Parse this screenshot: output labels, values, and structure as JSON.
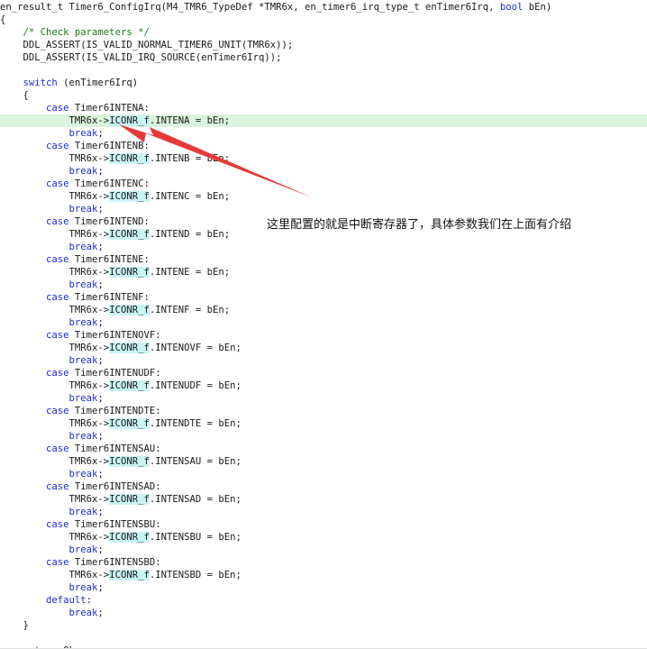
{
  "editor": {
    "current_line": 9,
    "lines": [
      [
        {
          "t": "en_result_t Timer6_ConfigIrq(M4_TMR6_TypeDef *TMR6x, en_timer6_irq_type_t enTimer6Irq, "
        },
        {
          "t": "bool",
          "c": "kw"
        },
        {
          "t": " bEn)"
        }
      ],
      [
        {
          "t": "{"
        }
      ],
      [
        {
          "t": "    "
        },
        {
          "t": "/* Check parameters */",
          "c": "cm"
        }
      ],
      [
        {
          "t": "    DDL_ASSERT(IS_VALID_NORMAL_TIMER6_UNIT(TMR6x));"
        }
      ],
      [
        {
          "t": "    DDL_ASSERT(IS_VALID_IRQ_SOURCE(enTimer6Irq));"
        }
      ],
      [
        {
          "t": ""
        }
      ],
      [
        {
          "t": "    "
        },
        {
          "t": "switch",
          "c": "kw"
        },
        {
          "t": " (enTimer6Irq)"
        }
      ],
      [
        {
          "t": "    {"
        }
      ],
      [
        {
          "t": "        "
        },
        {
          "t": "case",
          "c": "kw"
        },
        {
          "t": " Timer6INTENA:"
        }
      ],
      [
        {
          "t": "            TMR6x->"
        },
        {
          "t": "ICONR_f",
          "c": "hl"
        },
        {
          "t": ".INTENA = bEn;"
        }
      ],
      [
        {
          "t": "            "
        },
        {
          "t": "break",
          "c": "kw"
        },
        {
          "t": ";"
        }
      ],
      [
        {
          "t": "        "
        },
        {
          "t": "case",
          "c": "kw"
        },
        {
          "t": " Timer6INTENB:"
        }
      ],
      [
        {
          "t": "            TMR6x->"
        },
        {
          "t": "ICONR_f",
          "c": "hl"
        },
        {
          "t": ".INTENB = bEn;"
        }
      ],
      [
        {
          "t": "            "
        },
        {
          "t": "break",
          "c": "kw"
        },
        {
          "t": ";"
        }
      ],
      [
        {
          "t": "        "
        },
        {
          "t": "case",
          "c": "kw"
        },
        {
          "t": " Timer6INTENC:"
        }
      ],
      [
        {
          "t": "            TMR6x->"
        },
        {
          "t": "ICONR_f",
          "c": "hl"
        },
        {
          "t": ".INTENC = bEn;"
        }
      ],
      [
        {
          "t": "            "
        },
        {
          "t": "break",
          "c": "kw"
        },
        {
          "t": ";"
        }
      ],
      [
        {
          "t": "        "
        },
        {
          "t": "case",
          "c": "kw"
        },
        {
          "t": " Timer6INTEND:"
        }
      ],
      [
        {
          "t": "            TMR6x->"
        },
        {
          "t": "ICONR_f",
          "c": "hl"
        },
        {
          "t": ".INTEND = bEn;"
        }
      ],
      [
        {
          "t": "            "
        },
        {
          "t": "break",
          "c": "kw"
        },
        {
          "t": ";"
        }
      ],
      [
        {
          "t": "        "
        },
        {
          "t": "case",
          "c": "kw"
        },
        {
          "t": " Timer6INTENE:"
        }
      ],
      [
        {
          "t": "            TMR6x->"
        },
        {
          "t": "ICONR_f",
          "c": "hl"
        },
        {
          "t": ".INTENE = bEn;"
        }
      ],
      [
        {
          "t": "            "
        },
        {
          "t": "break",
          "c": "kw"
        },
        {
          "t": ";"
        }
      ],
      [
        {
          "t": "        "
        },
        {
          "t": "case",
          "c": "kw"
        },
        {
          "t": " Timer6INTENF:"
        }
      ],
      [
        {
          "t": "            TMR6x->"
        },
        {
          "t": "ICONR_f",
          "c": "hl"
        },
        {
          "t": ".INTENF = bEn;"
        }
      ],
      [
        {
          "t": "            "
        },
        {
          "t": "break",
          "c": "kw"
        },
        {
          "t": ";"
        }
      ],
      [
        {
          "t": "        "
        },
        {
          "t": "case",
          "c": "kw"
        },
        {
          "t": " Timer6INTENOVF:"
        }
      ],
      [
        {
          "t": "            TMR6x->"
        },
        {
          "t": "ICONR_f",
          "c": "hl"
        },
        {
          "t": ".INTENOVF = bEn;"
        }
      ],
      [
        {
          "t": "            "
        },
        {
          "t": "break",
          "c": "kw"
        },
        {
          "t": ";"
        }
      ],
      [
        {
          "t": "        "
        },
        {
          "t": "case",
          "c": "kw"
        },
        {
          "t": " Timer6INTENUDF:"
        }
      ],
      [
        {
          "t": "            TMR6x->"
        },
        {
          "t": "ICONR_f",
          "c": "hl"
        },
        {
          "t": ".INTENUDF = bEn;"
        }
      ],
      [
        {
          "t": "            "
        },
        {
          "t": "break",
          "c": "kw"
        },
        {
          "t": ";"
        }
      ],
      [
        {
          "t": "        "
        },
        {
          "t": "case",
          "c": "kw"
        },
        {
          "t": " Timer6INTENDTE:"
        }
      ],
      [
        {
          "t": "            TMR6x->"
        },
        {
          "t": "ICONR_f",
          "c": "hl"
        },
        {
          "t": ".INTENDTE = bEn;"
        }
      ],
      [
        {
          "t": "            "
        },
        {
          "t": "break",
          "c": "kw"
        },
        {
          "t": ";"
        }
      ],
      [
        {
          "t": "        "
        },
        {
          "t": "case",
          "c": "kw"
        },
        {
          "t": " Timer6INTENSAU:"
        }
      ],
      [
        {
          "t": "            TMR6x->"
        },
        {
          "t": "ICONR_f",
          "c": "hl"
        },
        {
          "t": ".INTENSAU = bEn;"
        }
      ],
      [
        {
          "t": "            "
        },
        {
          "t": "break",
          "c": "kw"
        },
        {
          "t": ";"
        }
      ],
      [
        {
          "t": "        "
        },
        {
          "t": "case",
          "c": "kw"
        },
        {
          "t": " Timer6INTENSAD:"
        }
      ],
      [
        {
          "t": "            TMR6x->"
        },
        {
          "t": "ICONR_f",
          "c": "hl"
        },
        {
          "t": ".INTENSAD = bEn;"
        }
      ],
      [
        {
          "t": "            "
        },
        {
          "t": "break",
          "c": "kw"
        },
        {
          "t": ";"
        }
      ],
      [
        {
          "t": "        "
        },
        {
          "t": "case",
          "c": "kw"
        },
        {
          "t": " Timer6INTENSBU:"
        }
      ],
      [
        {
          "t": "            TMR6x->"
        },
        {
          "t": "ICONR_f",
          "c": "hl"
        },
        {
          "t": ".INTENSBU = bEn;"
        }
      ],
      [
        {
          "t": "            "
        },
        {
          "t": "break",
          "c": "kw"
        },
        {
          "t": ";"
        }
      ],
      [
        {
          "t": "        "
        },
        {
          "t": "case",
          "c": "kw"
        },
        {
          "t": " Timer6INTENSBD:"
        }
      ],
      [
        {
          "t": "            TMR6x->"
        },
        {
          "t": "ICONR_f",
          "c": "hl"
        },
        {
          "t": ".INTENSBD = bEn;"
        }
      ],
      [
        {
          "t": "            "
        },
        {
          "t": "break",
          "c": "kw"
        },
        {
          "t": ";"
        }
      ],
      [
        {
          "t": "        "
        },
        {
          "t": "default",
          "c": "kw"
        },
        {
          "t": ":"
        }
      ],
      [
        {
          "t": "            "
        },
        {
          "t": "break",
          "c": "kw"
        },
        {
          "t": ";"
        }
      ],
      [
        {
          "t": "    }"
        }
      ],
      [
        {
          "t": ""
        }
      ],
      [
        {
          "t": "    "
        },
        {
          "t": "return",
          "c": "kw"
        },
        {
          "t": " Ok;"
        }
      ]
    ]
  },
  "annotation": {
    "text": "这里配置的就是中断寄存器了，具体参数我们在上面有介绍",
    "arrow_color": "#e53a3a"
  }
}
